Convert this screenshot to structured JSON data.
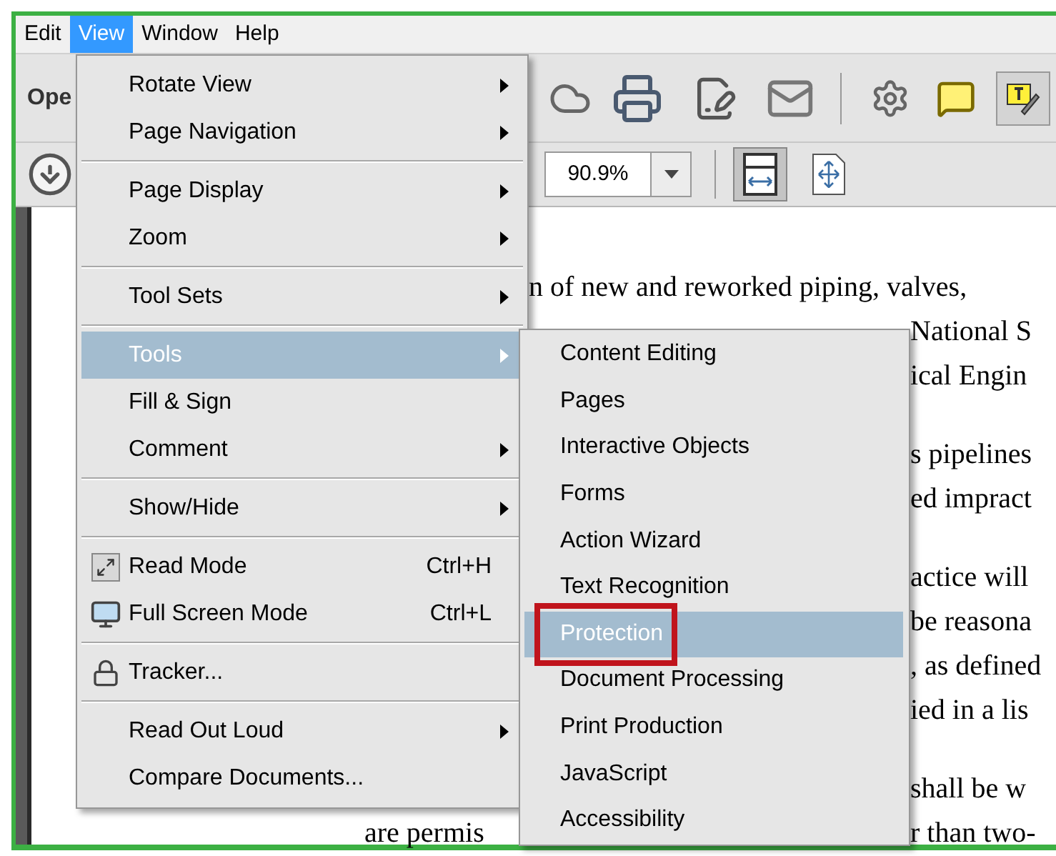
{
  "menu_bar": [
    {
      "label": "Edit",
      "selected": false
    },
    {
      "label": "View",
      "selected": true
    },
    {
      "label": "Window",
      "selected": false
    },
    {
      "label": "Help",
      "selected": false
    }
  ],
  "toolbar": {
    "button_label": "Ope"
  },
  "zoom": {
    "value": "90.9%"
  },
  "document": {
    "paragraphs": [
      {
        "lines": [
          [
            {
              "text": "n of new and reworked piping, valves,",
              "kind": "after-view-menu"
            }
          ],
          [
            {
              "text": "National S",
              "kind": "after-submenu"
            }
          ],
          [
            {
              "text": "ical Engin",
              "kind": "after-submenu"
            }
          ]
        ]
      },
      {
        "lines": [
          [
            {
              "text": "s pipelines",
              "kind": "after-submenu"
            }
          ],
          [
            {
              "text": "ed impract",
              "kind": "after-submenu"
            }
          ]
        ]
      },
      {
        "lines": [
          [
            {
              "text": "actice will",
              "kind": "after-submenu"
            }
          ],
          [
            {
              "text": "be reasona",
              "kind": "after-submenu"
            }
          ],
          [
            {
              "text": ", as defined",
              "kind": "after-submenu"
            }
          ],
          [
            {
              "text": "ied in a lis",
              "kind": "after-submenu"
            }
          ]
        ]
      },
      {
        "lines": [
          [
            {
              "text": "shall be w",
              "kind": "after-submenu"
            }
          ],
          [
            {
              "text": "are permis",
              "kind": "page-margin"
            },
            {
              "text": "r than two-",
              "kind": "after-submenu"
            }
          ]
        ]
      }
    ]
  },
  "view_menu": {
    "items": [
      {
        "kind": "item",
        "label": "Rotate View",
        "submenu": true,
        "selected": false
      },
      {
        "kind": "item",
        "label": "Page Navigation",
        "submenu": true,
        "selected": false
      },
      {
        "kind": "separator"
      },
      {
        "kind": "item",
        "label": "Page Display",
        "submenu": true,
        "selected": false
      },
      {
        "kind": "item",
        "label": "Zoom",
        "submenu": true,
        "selected": false
      },
      {
        "kind": "separator"
      },
      {
        "kind": "item",
        "label": "Tool Sets",
        "submenu": true,
        "selected": false
      },
      {
        "kind": "separator"
      },
      {
        "kind": "item",
        "label": "Tools",
        "submenu": true,
        "selected": true
      },
      {
        "kind": "item",
        "label": "Fill & Sign",
        "submenu": false,
        "selected": false
      },
      {
        "kind": "item",
        "label": "Comment",
        "submenu": true,
        "selected": false
      },
      {
        "kind": "separator"
      },
      {
        "kind": "item",
        "label": "Show/Hide",
        "submenu": true,
        "selected": false
      },
      {
        "kind": "separator"
      },
      {
        "kind": "expand",
        "label": "Read Mode",
        "submenu": false,
        "selected": false,
        "shortcut": "Ctrl+H"
      },
      {
        "kind": "monitor",
        "label": "Full Screen Mode",
        "submenu": false,
        "selected": false,
        "shortcut": "Ctrl+L"
      },
      {
        "kind": "separator"
      },
      {
        "kind": "lock",
        "label": "Tracker...",
        "submenu": false,
        "selected": false
      },
      {
        "kind": "separator"
      },
      {
        "kind": "item",
        "label": "Read Out Loud",
        "submenu": true,
        "selected": false
      },
      {
        "kind": "item",
        "label": "Compare Documents...",
        "submenu": false,
        "selected": false
      }
    ]
  },
  "tools_submenu": {
    "items": [
      {
        "label": "Content Editing",
        "selected": false,
        "outlined": false
      },
      {
        "label": "Pages",
        "selected": false,
        "outlined": false
      },
      {
        "label": "Interactive Objects",
        "selected": false,
        "outlined": false
      },
      {
        "label": "Forms",
        "selected": false,
        "outlined": false
      },
      {
        "label": "Action Wizard",
        "selected": false,
        "outlined": false
      },
      {
        "label": "Text Recognition",
        "selected": false,
        "outlined": false
      },
      {
        "label": "Protection",
        "selected": true,
        "outlined": true
      },
      {
        "label": "Document Processing",
        "selected": false,
        "outlined": false
      },
      {
        "label": "Print Production",
        "selected": false,
        "outlined": false
      },
      {
        "label": "JavaScript",
        "selected": false,
        "outlined": false
      },
      {
        "label": "Accessibility",
        "selected": false,
        "outlined": false
      }
    ]
  }
}
